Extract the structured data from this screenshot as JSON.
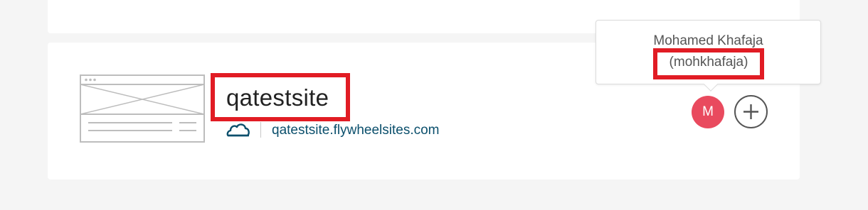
{
  "site": {
    "name": "qatestsite",
    "url": "qatestsite.flywheelsites.com"
  },
  "tooltip": {
    "full_name": "Mohamed Khafaja",
    "username": "(mohkhafaja)"
  },
  "collaborator": {
    "initial": "M"
  },
  "icons": {
    "thumbnail": "site-wireframe-icon",
    "host": "cloud-icon",
    "add": "plus-circle-icon"
  },
  "colors": {
    "highlight": "#e11c24",
    "avatar": "#e94a5e",
    "link": "#0b4f6c",
    "background": "#f5f5f5"
  }
}
